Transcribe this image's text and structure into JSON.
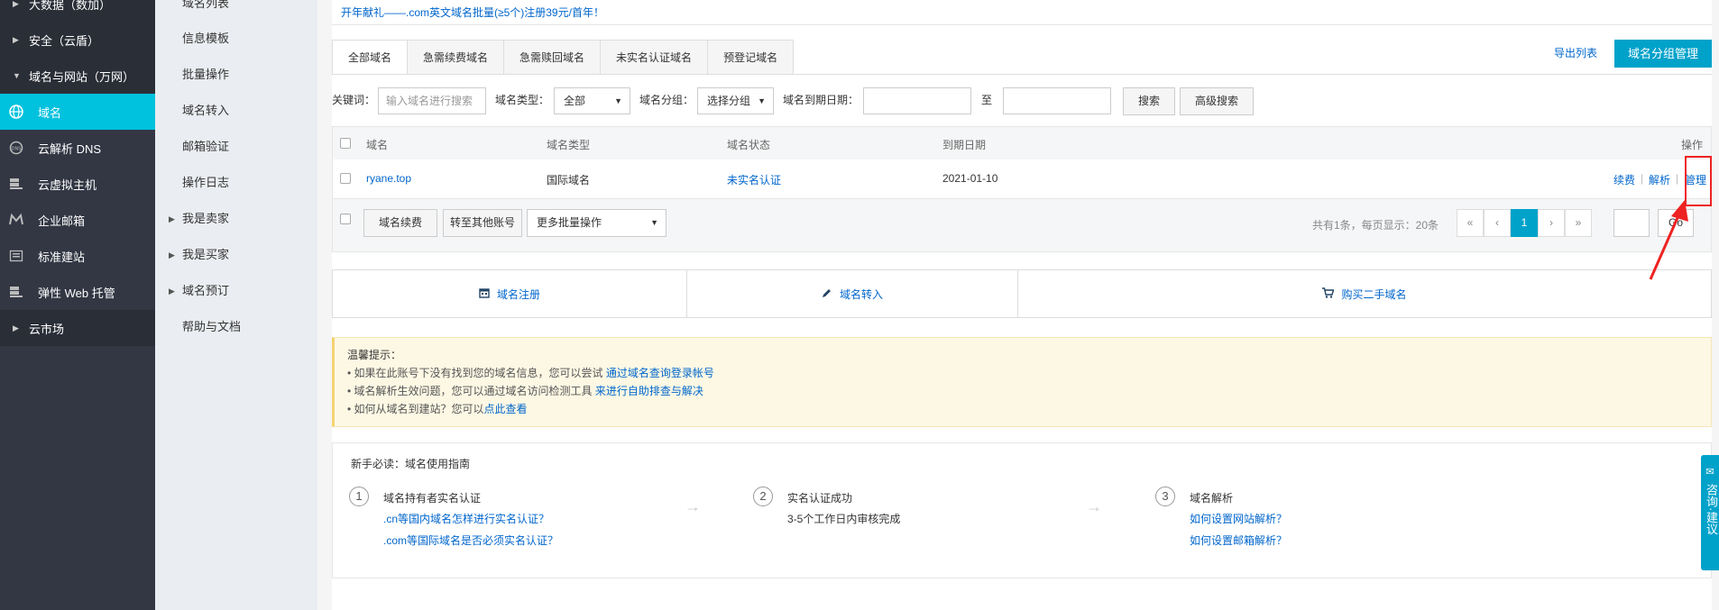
{
  "sidebar": {
    "items": [
      {
        "label": "大数据（数加）",
        "expand": "right",
        "icon": null
      },
      {
        "label": "安全（云盾）",
        "expand": "right",
        "icon": null
      },
      {
        "label": "域名与网站（万网）",
        "expand": "down",
        "icon": null
      },
      {
        "label": "域名",
        "icon": "globe-icon",
        "active": true
      },
      {
        "label": "云解析 DNS",
        "icon": "dns-icon"
      },
      {
        "label": "云虚拟主机",
        "icon": "server-icon"
      },
      {
        "label": "企业邮箱",
        "icon": "mail-icon"
      },
      {
        "label": "标准建站",
        "icon": "site-icon"
      },
      {
        "label": "弹性 Web 托管",
        "icon": "hosting-icon"
      },
      {
        "label": "云市场",
        "expand": "right",
        "icon": null
      }
    ]
  },
  "subnav": {
    "items": [
      "域名列表",
      "信息模板",
      "批量操作",
      "域名转入",
      "邮箱验证",
      "操作日志",
      "我是卖家",
      "我是买家",
      "域名预订",
      "帮助与文档"
    ]
  },
  "ad_text": "开年献礼——.com英文域名批量(≥5个)注册39元/首年！",
  "tabs": [
    "全部域名",
    "急需续费域名",
    "急需赎回域名",
    "未实名认证域名",
    "预登记域名"
  ],
  "export_label": "导出列表",
  "group_manage_label": "域名分组管理",
  "filter": {
    "keyword_label": "关键词：",
    "keyword_placeholder": "输入域名进行搜索",
    "type_label": "域名类型：",
    "type_value": "全部",
    "group_label": "域名分组：",
    "group_value": "选择分组",
    "expiry_label": "域名到期日期：",
    "to_label": "至",
    "search_label": "搜索",
    "advanced_label": "高级搜索"
  },
  "table": {
    "headers": [
      "域名",
      "域名类型",
      "域名状态",
      "到期日期",
      "操作"
    ],
    "rows": [
      {
        "domain": "ryane.top",
        "type": "国际域名",
        "status": "未实名认证",
        "expiry": "2021-01-10",
        "actions": [
          "续费",
          "解析",
          "管理"
        ]
      }
    ]
  },
  "batch": {
    "renew_label": "域名续费",
    "transfer_label": "转至其他账号",
    "more_label": "更多批量操作",
    "pager_info": "共有1条，每页显示：20条",
    "pages": [
      "«",
      "‹",
      "1",
      "›",
      "»"
    ],
    "go_label": "Go"
  },
  "quick_actions": [
    {
      "label": "域名注册",
      "icon": "calendar-icon"
    },
    {
      "label": "域名转入",
      "icon": "pencil-icon"
    },
    {
      "label": "购买二手域名",
      "icon": "cart-icon"
    }
  ],
  "tips": {
    "title": "温馨提示：",
    "lines": [
      {
        "text": "• 如果在此账号下没有找到您的域名信息，您可以尝试 ",
        "link": "通过域名查询登录帐号"
      },
      {
        "text": "• 域名解析生效问题，您可以通过域名访问检测工具 ",
        "link": "来进行自助排查与解决"
      },
      {
        "text": "• 如何从域名到建站？您可以",
        "link": "点此查看"
      }
    ]
  },
  "guide": {
    "title": "新手必读：域名使用指南",
    "steps": [
      {
        "num": "1",
        "title": "域名持有者实名认证",
        "lines": [
          ".cn等国内域名怎样进行实名认证？",
          ".com等国际域名是否必须实名认证？"
        ]
      },
      {
        "num": "2",
        "title": "实名认证成功",
        "lines": [
          "3-5个工作日内审核完成"
        ]
      },
      {
        "num": "3",
        "title": "域名解析",
        "lines": [
          "如何设置网站解析？",
          "如何设置邮箱解析？"
        ]
      }
    ]
  },
  "float_tab": "咨询·建议",
  "colors": {
    "accent": "#00a2ca",
    "sidebar_active": "#00c1de",
    "sidebar_bg": "#333744",
    "link": "#0066cc",
    "highlight": "#e22222"
  }
}
